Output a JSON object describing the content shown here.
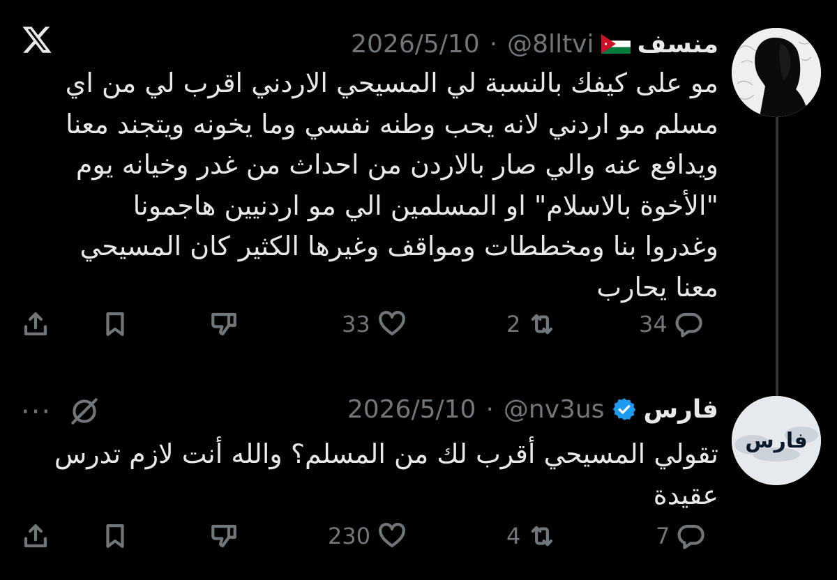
{
  "tweets": [
    {
      "name": "منسف",
      "handle": "@8lltvi",
      "date": "2026/5/10",
      "separator": "·",
      "flag_icon": "jordan-flag-icon",
      "text": "مو على كيفك بالنسبة لي المسيحي الاردني اقرب لي من اي\nمسلم مو اردني  لانه يحب وطنه نفسي وما يخونه ويتجند معنا\nويدافع عنه والي صار بالاردن من احداث من غدر وخيانه يوم\n\"الأخوة بالاسلام\" او المسلمين الي مو اردنيين هاجمونا\nوغدروا بنا ومخططات ومواقف وغيرها الكثير كان المسيحي\nمعنا يحارب",
      "replies": "34",
      "retweets": "2",
      "likes": "33"
    },
    {
      "name": "فارس",
      "handle": "@nv3us",
      "date": "2026/5/10",
      "separator": "·",
      "verified": true,
      "avatar_text": "فارس",
      "text": "تقولي المسيحي أقرب لك من المسلم؟ والله أنت لازم تدرس\nعقيدة",
      "replies": "7",
      "retweets": "4",
      "likes": "230"
    }
  ],
  "more_label": "···",
  "colors": {
    "background": "#000000",
    "text": "#e7e9ea",
    "muted": "#71767b",
    "verified": "#1d9bf0"
  },
  "icons": [
    "x-logo-icon",
    "reply-icon",
    "retweet-icon",
    "like-icon",
    "dislike-icon",
    "bookmark-icon",
    "share-icon",
    "mute-icon",
    "more-icon",
    "verified-badge-icon"
  ]
}
